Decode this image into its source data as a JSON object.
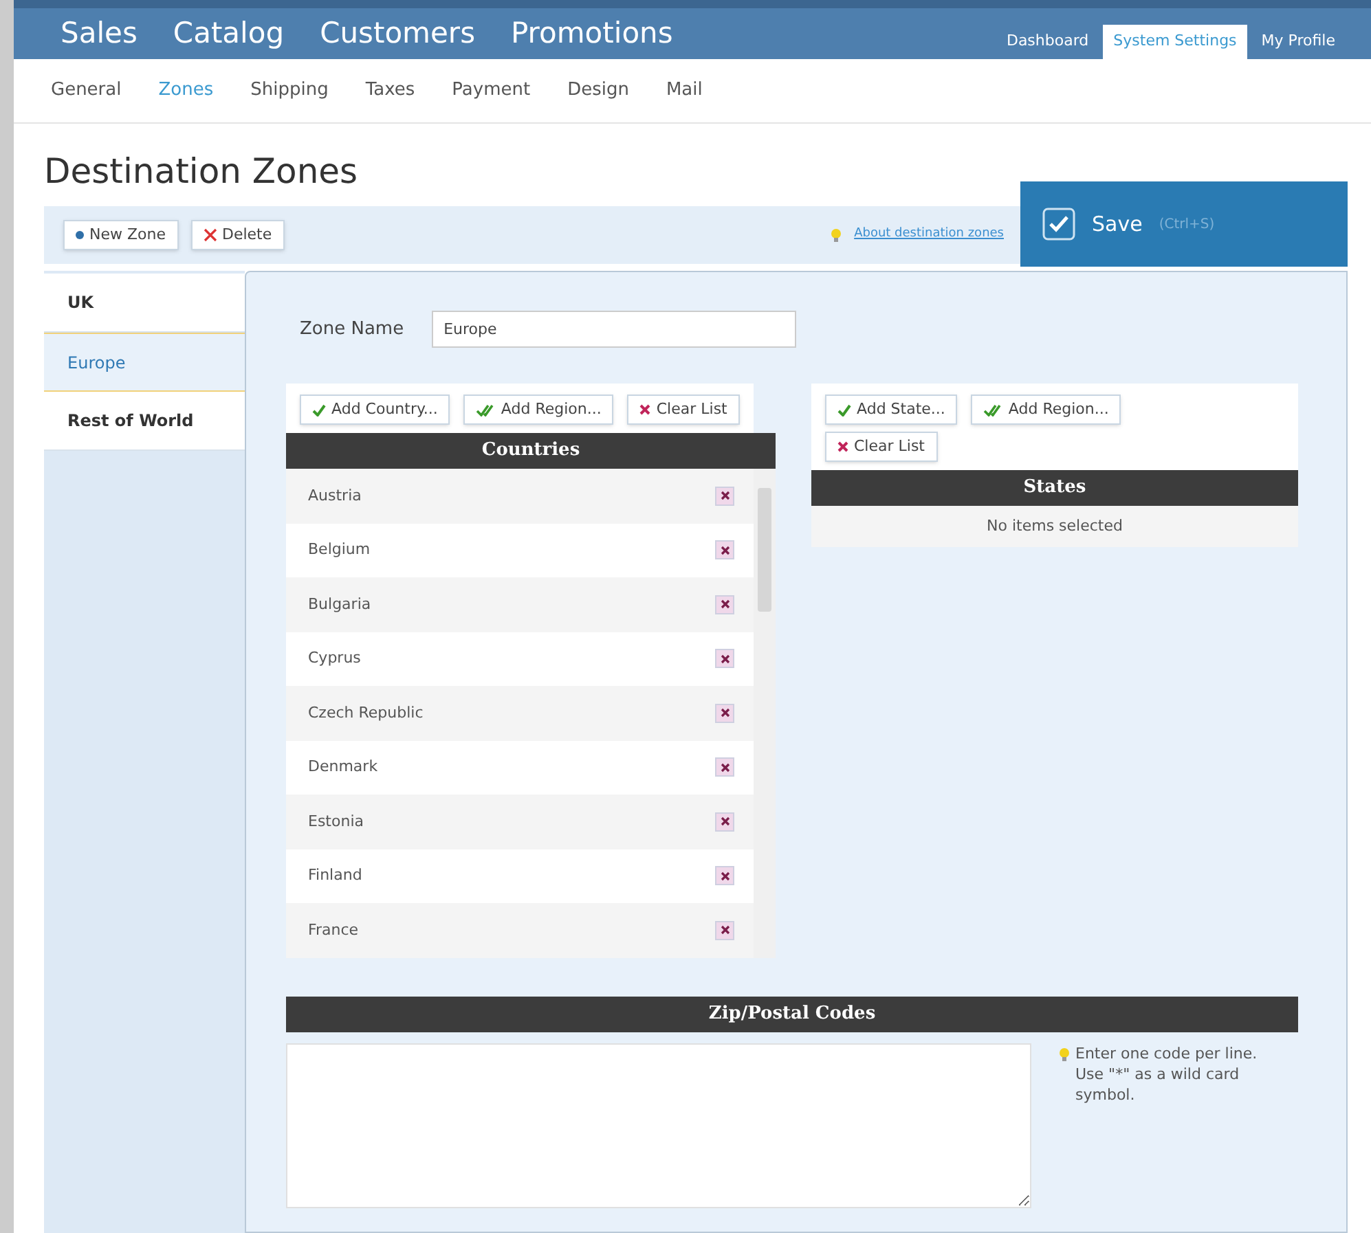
{
  "main_nav": [
    {
      "label": "Sales"
    },
    {
      "label": "Catalog"
    },
    {
      "label": "Customers"
    },
    {
      "label": "Promotions"
    }
  ],
  "top_tabs": [
    {
      "label": "Dashboard",
      "selected": false
    },
    {
      "label": "System Settings",
      "selected": true
    },
    {
      "label": "My Profile",
      "selected": false
    }
  ],
  "sub_nav": [
    {
      "label": "General",
      "selected": false
    },
    {
      "label": "Zones",
      "selected": true
    },
    {
      "label": "Shipping",
      "selected": false
    },
    {
      "label": "Taxes",
      "selected": false
    },
    {
      "label": "Payment",
      "selected": false
    },
    {
      "label": "Design",
      "selected": false
    },
    {
      "label": "Mail",
      "selected": false
    }
  ],
  "page_title": "Destination Zones",
  "toolbar": {
    "buttons": [
      {
        "kind": "new",
        "label": "New Zone"
      },
      {
        "kind": "delete",
        "label": "Delete"
      }
    ],
    "help_link": "About destination zones"
  },
  "save": {
    "label": "Save",
    "shortcut": "(Ctrl+S)"
  },
  "zones": [
    {
      "label": "UK",
      "selected": false
    },
    {
      "label": "Europe",
      "selected": true
    },
    {
      "label": "Rest of World",
      "selected": false
    }
  ],
  "zone_name": {
    "label": "Zone Name",
    "value": "Europe"
  },
  "countries": {
    "title": "Countries",
    "buttons": [
      {
        "kind": "add",
        "label": "Add Country..."
      },
      {
        "kind": "region",
        "label": "Add Region..."
      },
      {
        "kind": "clear",
        "label": "Clear List"
      }
    ],
    "items": [
      "Austria",
      "Belgium",
      "Bulgaria",
      "Cyprus",
      "Czech Republic",
      "Denmark",
      "Estonia",
      "Finland",
      "France"
    ]
  },
  "states": {
    "title": "States",
    "buttons": [
      {
        "kind": "add",
        "label": "Add State..."
      },
      {
        "kind": "region",
        "label": "Add Region..."
      },
      {
        "kind": "clear",
        "label": "Clear List"
      }
    ],
    "empty": "No items selected"
  },
  "zip": {
    "title": "Zip/Postal Codes",
    "hint": "Enter one code per line.\nUse \"*\" as a wild card symbol."
  }
}
